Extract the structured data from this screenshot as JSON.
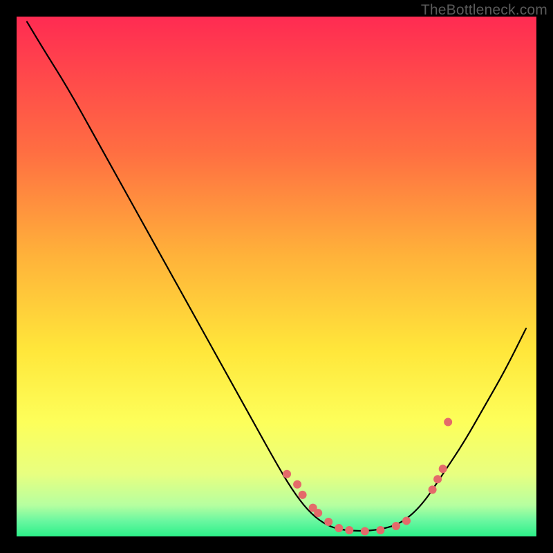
{
  "watermark": "TheBottleneck.com",
  "chart_data": {
    "type": "line",
    "title": "",
    "xlabel": "",
    "ylabel": "",
    "xlim": [
      0,
      100
    ],
    "ylim": [
      0,
      100
    ],
    "grid": false,
    "legend": false,
    "background_gradient": {
      "top": "#ff2b52",
      "mid1": "#ffb23a",
      "mid2": "#ffe63a",
      "mid3": "#f4ff7a",
      "bottom": "#2cf089"
    },
    "series": [
      {
        "name": "curve",
        "color": "#000000",
        "x": [
          2,
          5,
          10,
          15,
          20,
          25,
          30,
          35,
          40,
          45,
          50,
          53,
          56,
          59,
          62,
          66,
          70,
          74,
          78,
          82,
          86,
          90,
          94,
          98
        ],
        "y": [
          99,
          94,
          86,
          77,
          68,
          59,
          50,
          41,
          32,
          23,
          14,
          9,
          5,
          2.5,
          1.3,
          1.0,
          1.3,
          2.5,
          6,
          12,
          18,
          25,
          32,
          40
        ]
      },
      {
        "name": "markers",
        "color": "#e46a6a",
        "type": "scatter",
        "x": [
          52,
          54,
          55,
          57,
          58,
          60,
          62,
          64,
          67,
          70,
          73,
          75,
          80,
          81,
          82,
          83
        ],
        "y": [
          12,
          10,
          8,
          5.5,
          4.5,
          2.8,
          1.6,
          1.2,
          1.0,
          1.2,
          2.0,
          3.0,
          9,
          11,
          13,
          22
        ]
      }
    ]
  }
}
